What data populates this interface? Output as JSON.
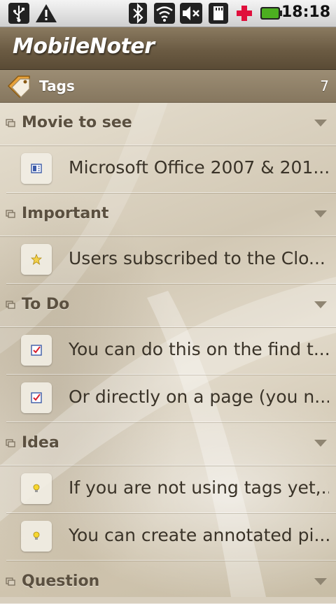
{
  "status_bar": {
    "time": "18:18",
    "icons": [
      "usb-icon",
      "warning-icon",
      "bluetooth-icon",
      "wifi-icon",
      "mute-icon",
      "sd-card-icon",
      "plus-icon",
      "battery-icon"
    ],
    "colors": {
      "plus": "#e0103c",
      "battery": "#4caf20"
    }
  },
  "app": {
    "title": "MobileNoter"
  },
  "tags": {
    "label": "Tags",
    "count": "7"
  },
  "groups": [
    {
      "name": "Movie to see",
      "notes": [
        {
          "text": "Microsoft Office 2007 & 201...",
          "icon": "page-icon"
        }
      ]
    },
    {
      "name": "Important",
      "notes": [
        {
          "text": "Users subscribed to the Clo...",
          "icon": "star-icon"
        }
      ]
    },
    {
      "name": "To Do",
      "notes": [
        {
          "text": "You can do this on the find t...",
          "icon": "checkbox-icon"
        },
        {
          "text": "Or directly on a page (you n...",
          "icon": "checkbox-icon"
        }
      ]
    },
    {
      "name": "Idea",
      "notes": [
        {
          "text": "If you are not using tags yet,...",
          "icon": "lightbulb-icon"
        },
        {
          "text": "You can create annotated pi...",
          "icon": "lightbulb-icon"
        }
      ]
    },
    {
      "name": "Question",
      "notes": []
    }
  ]
}
